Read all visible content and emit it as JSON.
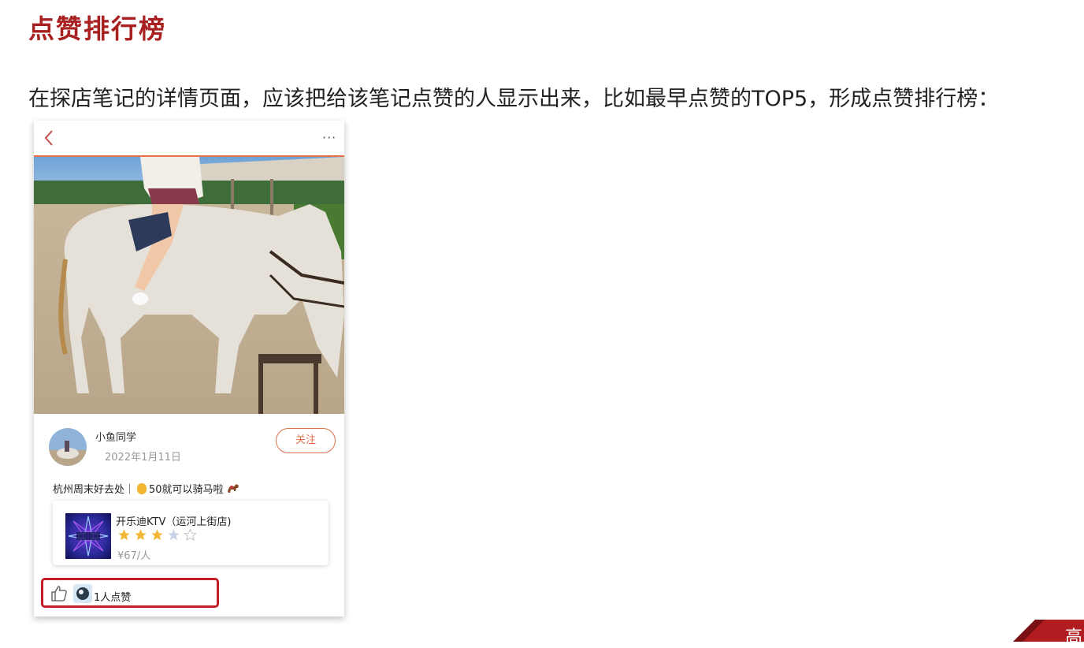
{
  "slide": {
    "title": "点赞排行榜",
    "description": "在探店笔记的详情页面，应该把给该笔记点赞的人显示出来，比如最早点赞的TOP5，形成点赞排行榜：",
    "corner_char": "高"
  },
  "phone": {
    "header": {
      "back_icon": "chevron-left-icon",
      "more_label": "···"
    },
    "author": {
      "name": "小鱼同学",
      "date": "2022年1月11日"
    },
    "follow_label": "关注",
    "post": {
      "text_part1": "杭州周末好去处｜",
      "text_part2": "50就可以骑马啦"
    },
    "shop": {
      "name": "开乐迪KTV（运河上街店)",
      "rating": 3,
      "max_rating": 5,
      "price": "¥67/人"
    },
    "likes": {
      "count_text": "1人点赞"
    }
  },
  "colors": {
    "title_red": "#a8201f",
    "accent_orange": "#e0704a",
    "highlight_red": "#c21e24",
    "star_gold": "#f2b632"
  }
}
